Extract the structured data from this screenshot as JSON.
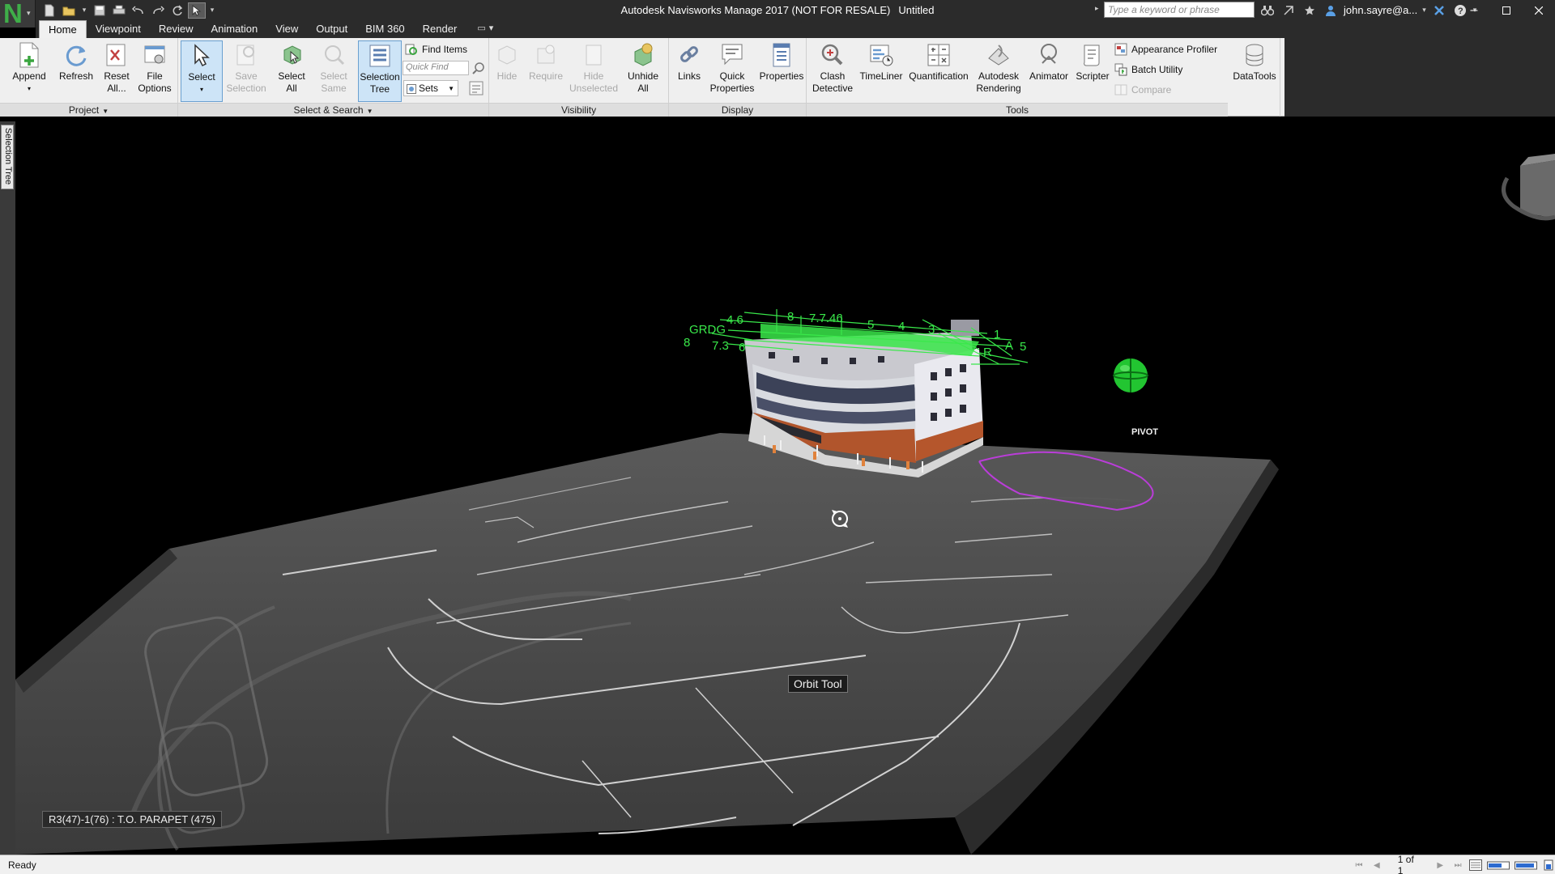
{
  "titlebar": {
    "app_title": "Autodesk Navisworks Manage 2017 (NOT FOR RESALE)",
    "doc_title": "Untitled",
    "search_placeholder": "Type a keyword or phrase",
    "user_name": "john.sayre@a..."
  },
  "app_logo": "N",
  "ribbon_tabs": [
    "Home",
    "Viewpoint",
    "Review",
    "Animation",
    "View",
    "Output",
    "BIM 360",
    "Render"
  ],
  "active_tab": "Home",
  "ribbon": {
    "project": {
      "label": "Project",
      "append": "Append",
      "refresh": "Refresh",
      "reset_all_1": "Reset",
      "reset_all_2": "All...",
      "file_options_1": "File",
      "file_options_2": "Options"
    },
    "select_search": {
      "label": "Select & Search",
      "select": "Select",
      "save_selection_1": "Save",
      "save_selection_2": "Selection",
      "select_all_1": "Select",
      "select_all_2": "All",
      "select_same_1": "Select",
      "select_same_2": "Same",
      "selection_tree_1": "Selection",
      "selection_tree_2": "Tree",
      "find_items": "Find Items",
      "quick_find_placeholder": "Quick Find",
      "sets": "Sets"
    },
    "visibility": {
      "label": "Visibility",
      "hide": "Hide",
      "require": "Require",
      "hide_unselected_1": "Hide",
      "hide_unselected_2": "Unselected",
      "unhide_all_1": "Unhide",
      "unhide_all_2": "All"
    },
    "display": {
      "label": "Display",
      "links": "Links",
      "quick_properties_1": "Quick",
      "quick_properties_2": "Properties",
      "properties": "Properties"
    },
    "tools": {
      "label": "Tools",
      "clash_detective_1": "Clash",
      "clash_detective_2": "Detective",
      "timeliner": "TimeLiner",
      "quantification": "Quantification",
      "autodesk_rendering_1": "Autodesk",
      "autodesk_rendering_2": "Rendering",
      "animator": "Animator",
      "scripter": "Scripter",
      "appearance_profiler": "Appearance Profiler",
      "batch_utility": "Batch Utility",
      "compare": "Compare"
    },
    "datatools": "DataTools"
  },
  "side_tab": "Selection Tree",
  "viewport": {
    "pivot_label": "PIVOT",
    "orbit_tooltip": "Orbit Tool",
    "element_tooltip": "R3(47)-1(76) : T.O. PARAPET (475)",
    "grid_labels": [
      "GRDG",
      "4.6",
      "8",
      "7.7.46",
      "5",
      "4",
      "3",
      "1",
      "8",
      "7.3",
      "6",
      "5",
      "A",
      "R"
    ]
  },
  "status": {
    "text": "Ready",
    "page": "1 of 1"
  },
  "colors": {
    "app_logo": "#3fae49",
    "grid_green": "#39e84a",
    "pivot_green": "#22c531",
    "selection_blue": "#cde4f7",
    "titlebar": "#2b2b2b",
    "ribbon": "#efefef",
    "boundary_magenta": "#c03ce0"
  }
}
